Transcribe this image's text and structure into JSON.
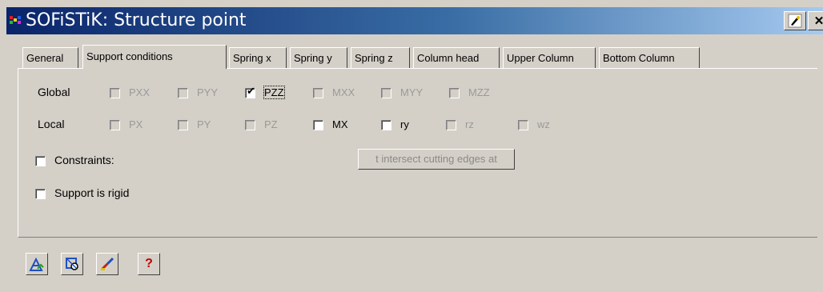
{
  "window": {
    "title": "SOFiSTiK: Structure point",
    "close_glyph": "✕"
  },
  "tabs": [
    {
      "label": "General"
    },
    {
      "label": "Support conditions"
    },
    {
      "label": "Spring x"
    },
    {
      "label": "Spring y"
    },
    {
      "label": "Spring z"
    },
    {
      "label": "Column head"
    },
    {
      "label": "Upper Column"
    },
    {
      "label": "Bottom Column"
    }
  ],
  "global": {
    "label": "Global",
    "items": [
      {
        "label": "PXX",
        "checked": false,
        "enabled": false
      },
      {
        "label": "PYY",
        "checked": false,
        "enabled": false
      },
      {
        "label": "PZZ",
        "checked": true,
        "enabled": true
      },
      {
        "label": "MXX",
        "checked": false,
        "enabled": false
      },
      {
        "label": "MYY",
        "checked": false,
        "enabled": false
      },
      {
        "label": "MZZ",
        "checked": false,
        "enabled": false
      }
    ]
  },
  "local": {
    "label": "Local",
    "items": [
      {
        "label": "PX",
        "checked": false,
        "enabled": false
      },
      {
        "label": "PY",
        "checked": false,
        "enabled": false
      },
      {
        "label": "PZ",
        "checked": false,
        "enabled": false
      },
      {
        "label": "MX",
        "checked": false,
        "enabled": true
      },
      {
        "label": "ry",
        "checked": false,
        "enabled": true
      },
      {
        "label": "rz",
        "checked": false,
        "enabled": false
      },
      {
        "label": "wz",
        "checked": false,
        "enabled": false
      }
    ]
  },
  "constraints": {
    "label": "Constraints:",
    "checked": false
  },
  "intersect_button": {
    "label": "t intersect cutting edges at"
  },
  "rigid": {
    "label": "Support is rigid",
    "checked": false
  },
  "toolbar": {
    "help_glyph": "?"
  },
  "colors": {
    "title_start": "#0a246a",
    "title_end": "#a6caf0",
    "face": "#d4d0c8",
    "disabled_text": "#9a9a9a"
  }
}
